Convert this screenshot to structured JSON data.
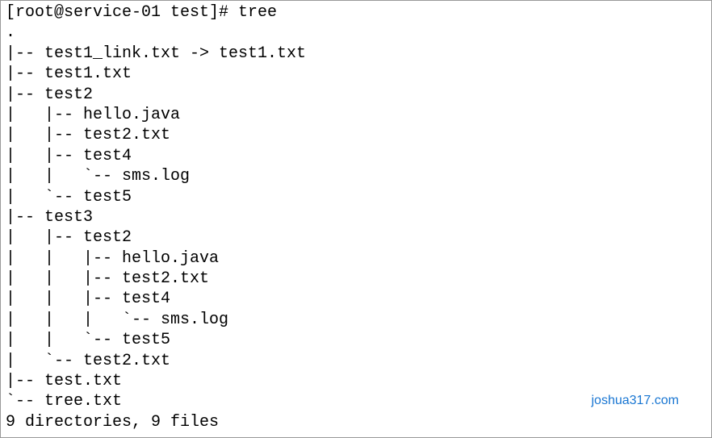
{
  "prompt": "[root@service-01 test]# tree",
  "tree": [
    ".",
    "|-- test1_link.txt -> test1.txt",
    "|-- test1.txt",
    "|-- test2",
    "|   |-- hello.java",
    "|   |-- test2.txt",
    "|   |-- test4",
    "|   |   `-- sms.log",
    "|   `-- test5",
    "|-- test3",
    "|   |-- test2",
    "|   |   |-- hello.java",
    "|   |   |-- test2.txt",
    "|   |   |-- test4",
    "|   |   |   `-- sms.log",
    "|   |   `-- test5",
    "|   `-- test2.txt",
    "|-- test.txt",
    "`-- tree.txt",
    "",
    "9 directories, 9 files"
  ],
  "watermark": "joshua317.com"
}
